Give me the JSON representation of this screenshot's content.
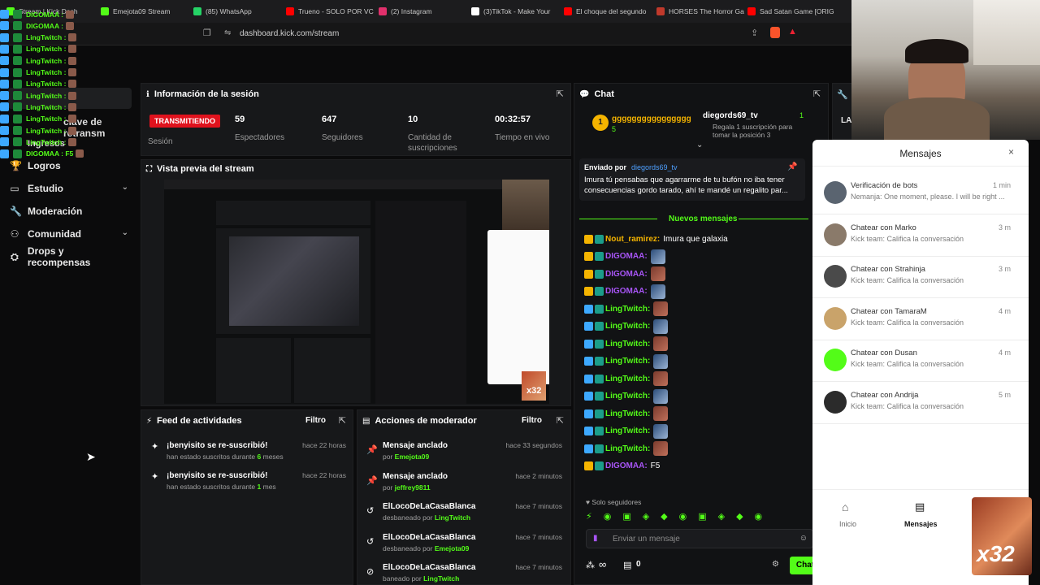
{
  "browser": {
    "tabs": [
      {
        "label": "Stream | Kick Dash",
        "color": "#53fc18"
      },
      {
        "label": "Emejota09 Stream",
        "color": "#53fc18"
      },
      {
        "label": "(85) WhatsApp",
        "color": "#25d366"
      },
      {
        "label": "Trueno - SOLO POR VC",
        "color": "#ff0000"
      },
      {
        "label": "(2) Instagram",
        "color": "#e1306c"
      },
      {
        "label": "(3)TikTok - Make Your",
        "color": "#ffffff"
      },
      {
        "label": "El choque del segundo",
        "color": "#ff0000"
      },
      {
        "label": "HORSES The Horror Ga",
        "color": "#c0392b"
      },
      {
        "label": "Sad Satan Game [ORIG",
        "color": "#ff0000"
      }
    ],
    "url": "dashboard.kick.com/stream"
  },
  "overlay_chat": [
    {
      "user": "DIGOMAA :",
      "color": "#53fc18"
    },
    {
      "user": "DIGOMAA :",
      "color": "#53fc18"
    },
    {
      "user": "LingTwitch :",
      "color": "#53fc18"
    },
    {
      "user": "LingTwitch :",
      "color": "#53fc18"
    },
    {
      "user": "LingTwitch :",
      "color": "#53fc18"
    },
    {
      "user": "LingTwitch :",
      "color": "#53fc18"
    },
    {
      "user": "LingTwitch :",
      "color": "#53fc18"
    },
    {
      "user": "LingTwitch :",
      "color": "#53fc18"
    },
    {
      "user": "LingTwitch :",
      "color": "#53fc18"
    },
    {
      "user": "LingTwitch :",
      "color": "#53fc18"
    },
    {
      "user": "LingTwitch :",
      "color": "#53fc18"
    },
    {
      "user": "LingTwitch :",
      "color": "#53fc18"
    },
    {
      "user": "DIGOMAA : F5",
      "color": "#53fc18"
    }
  ],
  "sidebar": {
    "partial_1": "clave de retransm",
    "partial_2": "Ingresos",
    "items": [
      {
        "label": "Logros",
        "icon": "trophy-icon"
      },
      {
        "label": "Estudio",
        "icon": "tv-icon",
        "chevron": true
      },
      {
        "label": "Moderación",
        "icon": "wrench-icon"
      },
      {
        "label": "Comunidad",
        "icon": "community-icon",
        "chevron": true
      },
      {
        "label": "Drops y recompensas",
        "icon": "drops-icon"
      }
    ]
  },
  "session": {
    "title": "Información de la sesión",
    "status": "TRANSMITIENDO",
    "session_label": "Sesión",
    "stats": [
      {
        "value": "59",
        "label": "Espectadores"
      },
      {
        "value": "647",
        "label": "Seguidores"
      },
      {
        "value": "10",
        "label": "Cantidad de suscripciones"
      },
      {
        "value": "00:32:57",
        "label": "Tiempo en vivo"
      }
    ]
  },
  "preview": {
    "title": "Vista previa del stream",
    "watermark": "x32"
  },
  "feed": {
    "title": "Feed de actividades",
    "filter": "Filtro",
    "items": [
      {
        "title": "¡benyisito se re-suscribió!",
        "sub_pre": "han estado suscritos durante ",
        "sub_num": "6",
        "sub_post": " meses",
        "time": "hace 22 horas"
      },
      {
        "title": "¡benyisito se re-suscribió!",
        "sub_pre": "han estado suscritos durante ",
        "sub_num": "1",
        "sub_post": " mes",
        "time": "hace 22 horas"
      }
    ]
  },
  "mod": {
    "title": "Acciones de moderador",
    "filter": "Filtro",
    "items": [
      {
        "title": "Mensaje anclado",
        "by": "por ",
        "user": "Emejota09",
        "time": "hace 33 segundos",
        "icon": "pin-icon"
      },
      {
        "title": "Mensaje anclado",
        "by": "por ",
        "user": "jeffrey9811",
        "time": "hace 2 minutos",
        "icon": "pin-icon"
      },
      {
        "title": "ElLocoDeLaCasaBlanca",
        "by": "desbaneado por ",
        "user": "LingTwitch",
        "time": "hace 7 minutos",
        "icon": "undo-icon"
      },
      {
        "title": "ElLocoDeLaCasaBlanca",
        "by": "desbaneado por ",
        "user": "Emejota09",
        "time": "hace 7 minutos",
        "icon": "undo-icon"
      },
      {
        "title": "ElLocoDeLaCasaBlanca",
        "by": "baneado por ",
        "user": "LingTwitch",
        "time": "hace 7 minutos",
        "icon": "ban-icon"
      }
    ]
  },
  "chat": {
    "title": "Chat",
    "sub_top_user": "gggggggggggggggg",
    "sub_top_count": "5",
    "gift_user": "diegords69_tv",
    "gift_count": "1",
    "gift_text": "Regala 1 suscripción para tomar la posición 3",
    "pinned_label": "Enviado por",
    "pinned_user": "diegords69_tv",
    "pinned_text": "Imura tú pensabas que agarrarme de tu bufón no iba tener consecuencias gordo tarado, ahí te mandé un regalito par...",
    "new_messages": "Nuevos mensajes",
    "messages": [
      {
        "user": "Nout_ramirez:",
        "text": "Imura que galaxia",
        "emote": false
      },
      {
        "user": "DIGOMAA:",
        "text": "",
        "emote": true
      },
      {
        "user": "DIGOMAA:",
        "text": "",
        "emote": true
      },
      {
        "user": "DIGOMAA:",
        "text": "",
        "emote": true
      },
      {
        "user": "LingTwitch:",
        "text": "",
        "emote": true
      },
      {
        "user": "LingTwitch:",
        "text": "",
        "emote": true
      },
      {
        "user": "LingTwitch:",
        "text": "",
        "emote": true
      },
      {
        "user": "LingTwitch:",
        "text": "",
        "emote": true
      },
      {
        "user": "LingTwitch:",
        "text": "",
        "emote": true
      },
      {
        "user": "LingTwitch:",
        "text": "",
        "emote": true
      },
      {
        "user": "LingTwitch:",
        "text": "",
        "emote": true
      },
      {
        "user": "LingTwitch:",
        "text": "",
        "emote": true
      },
      {
        "user": "LingTwitch:",
        "text": "",
        "emote": true
      },
      {
        "user": "DIGOMAA:",
        "text": "F5",
        "emote": false
      }
    ],
    "followers_only": "Solo seguidores",
    "input_placeholder": "Enviar un mensaje",
    "infinity": "∞",
    "count": "0",
    "send": "Chat"
  },
  "messages_panel": {
    "title": "Mensajes",
    "rows": [
      {
        "name": "Verificación de bots",
        "preview": "Nemanja: One moment, please. I will be right ...",
        "time": "1 min",
        "color": "#5a6470"
      },
      {
        "name": "Chatear con Marko",
        "preview": "Kick team: Califica la conversación",
        "time": "3 m",
        "color": "#8a7a6a"
      },
      {
        "name": "Chatear con Strahinja",
        "preview": "Kick team: Califica la conversación",
        "time": "3 m",
        "color": "#4a4a4a"
      },
      {
        "name": "Chatear con TamaraM",
        "preview": "Kick team: Califica la conversación",
        "time": "4 m",
        "color": "#c9a36a"
      },
      {
        "name": "Chatear con Dusan",
        "preview": "Kick team: Califica la conversación",
        "time": "4 m",
        "color": "#53fc18"
      },
      {
        "name": "Chatear con Andrija",
        "preview": "Kick team: Califica la conversación",
        "time": "5 m",
        "color": "#2b2b2b"
      }
    ],
    "nav_home": "Inicio",
    "nav_messages": "Mensajes"
  },
  "corner_overlay": "x32",
  "accent": "#53fc18"
}
